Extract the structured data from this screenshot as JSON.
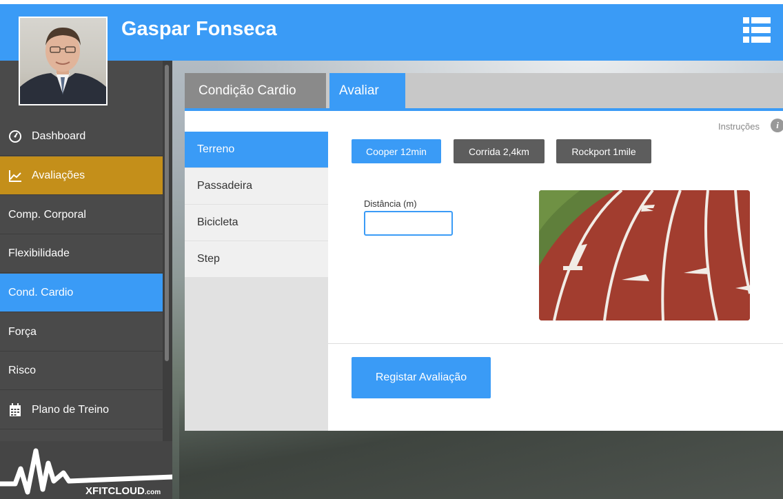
{
  "header": {
    "user_name": "Gaspar Fonseca"
  },
  "sidebar": {
    "items": [
      {
        "label": "Dashboard",
        "icon": "dashboard-gauge-icon"
      },
      {
        "label": "Avaliações",
        "icon": "line-chart-icon"
      },
      {
        "label": "Comp. Corporal"
      },
      {
        "label": "Flexibilidade"
      },
      {
        "label": "Cond. Cardio"
      },
      {
        "label": "Força"
      },
      {
        "label": "Risco"
      },
      {
        "label": "Plano de Treino",
        "icon": "calendar-icon"
      }
    ],
    "logo_text": "XFITCLOUD",
    "logo_suffix": ".com"
  },
  "tabs": {
    "section_label": "Condição Cardio",
    "active_label": "Avaliar"
  },
  "subnav": {
    "items": [
      "Terreno",
      "Passadeira",
      "Bicicleta",
      "Step"
    ],
    "active": "Terreno"
  },
  "content": {
    "instructions_label": "Instruções",
    "tests": [
      "Cooper 12min",
      "Corrida 2,4km",
      "Rockport 1mile"
    ],
    "active_test": "Cooper 12min",
    "distance_label": "Distância (m)",
    "distance_value": "",
    "submit_label": "Registar Avaliação"
  },
  "colors": {
    "accent_blue": "#3a9bf6",
    "active_orange": "#c48f1a",
    "sidebar_dark": "#4a4a4a",
    "button_gray": "#5d5d5d"
  }
}
